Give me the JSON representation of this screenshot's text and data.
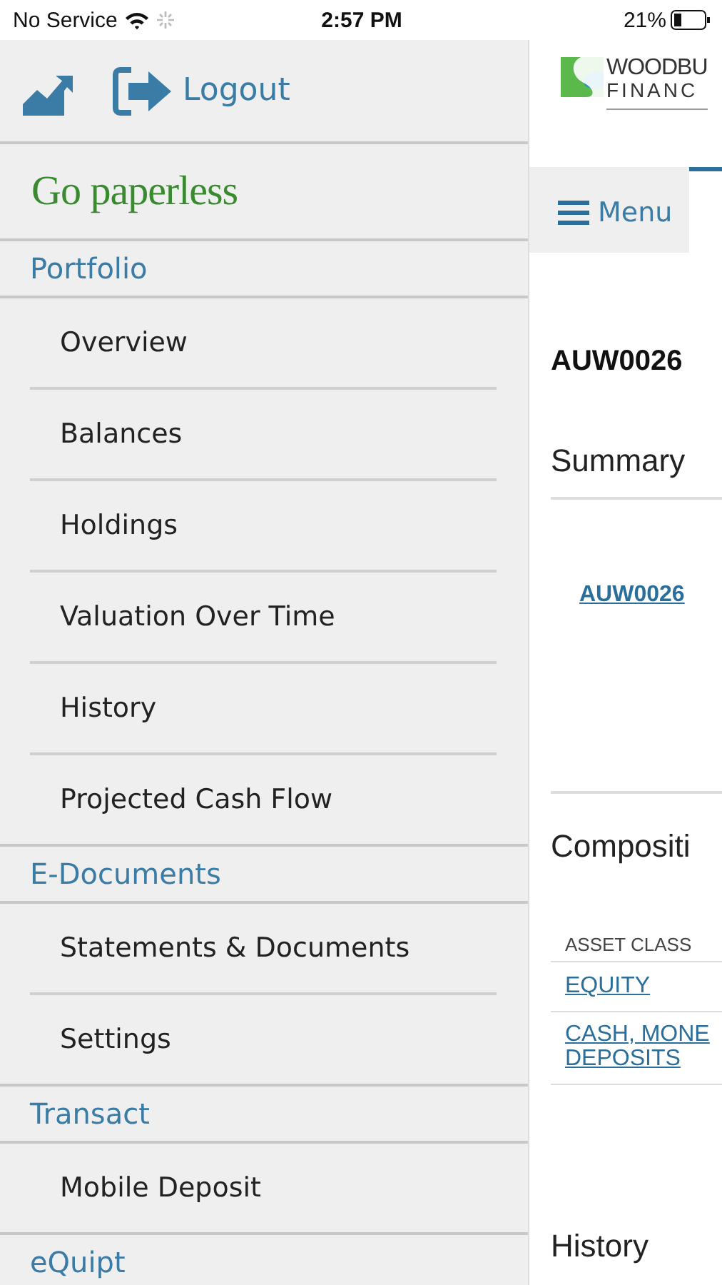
{
  "status_bar": {
    "carrier": "No Service",
    "time": "2:57 PM",
    "battery": "21%"
  },
  "sidebar": {
    "logout": "Logout",
    "promo": "Go paperless",
    "sections": [
      {
        "title": "Portfolio",
        "items": [
          {
            "label": "Overview"
          },
          {
            "label": "Balances"
          },
          {
            "label": "Holdings"
          },
          {
            "label": "Valuation Over Time"
          },
          {
            "label": "History"
          },
          {
            "label": "Projected Cash Flow"
          }
        ]
      },
      {
        "title": "E-Documents",
        "items": [
          {
            "label": "Statements & Documents"
          },
          {
            "label": "Settings"
          }
        ]
      },
      {
        "title": "Transact",
        "items": [
          {
            "label": "Mobile Deposit"
          }
        ]
      },
      {
        "title": "eQuipt"
      }
    ]
  },
  "content": {
    "logo": [
      "WOODBU",
      "FINANC"
    ],
    "tabs": [
      {
        "label": "Menu",
        "kind": "menu",
        "selected": false
      },
      {
        "kind": "tab",
        "selected": true
      }
    ],
    "account_title": "AUW0026",
    "summary_heading": "Summary",
    "account_link": "AUW0026",
    "composition_heading": "Compositi",
    "table": {
      "columns": [
        "ASSET CLASS"
      ],
      "rows": [
        [
          "EQUITY"
        ],
        [
          "CASH, MONE",
          "DEPOSITS"
        ]
      ]
    },
    "history_heading": "History"
  }
}
